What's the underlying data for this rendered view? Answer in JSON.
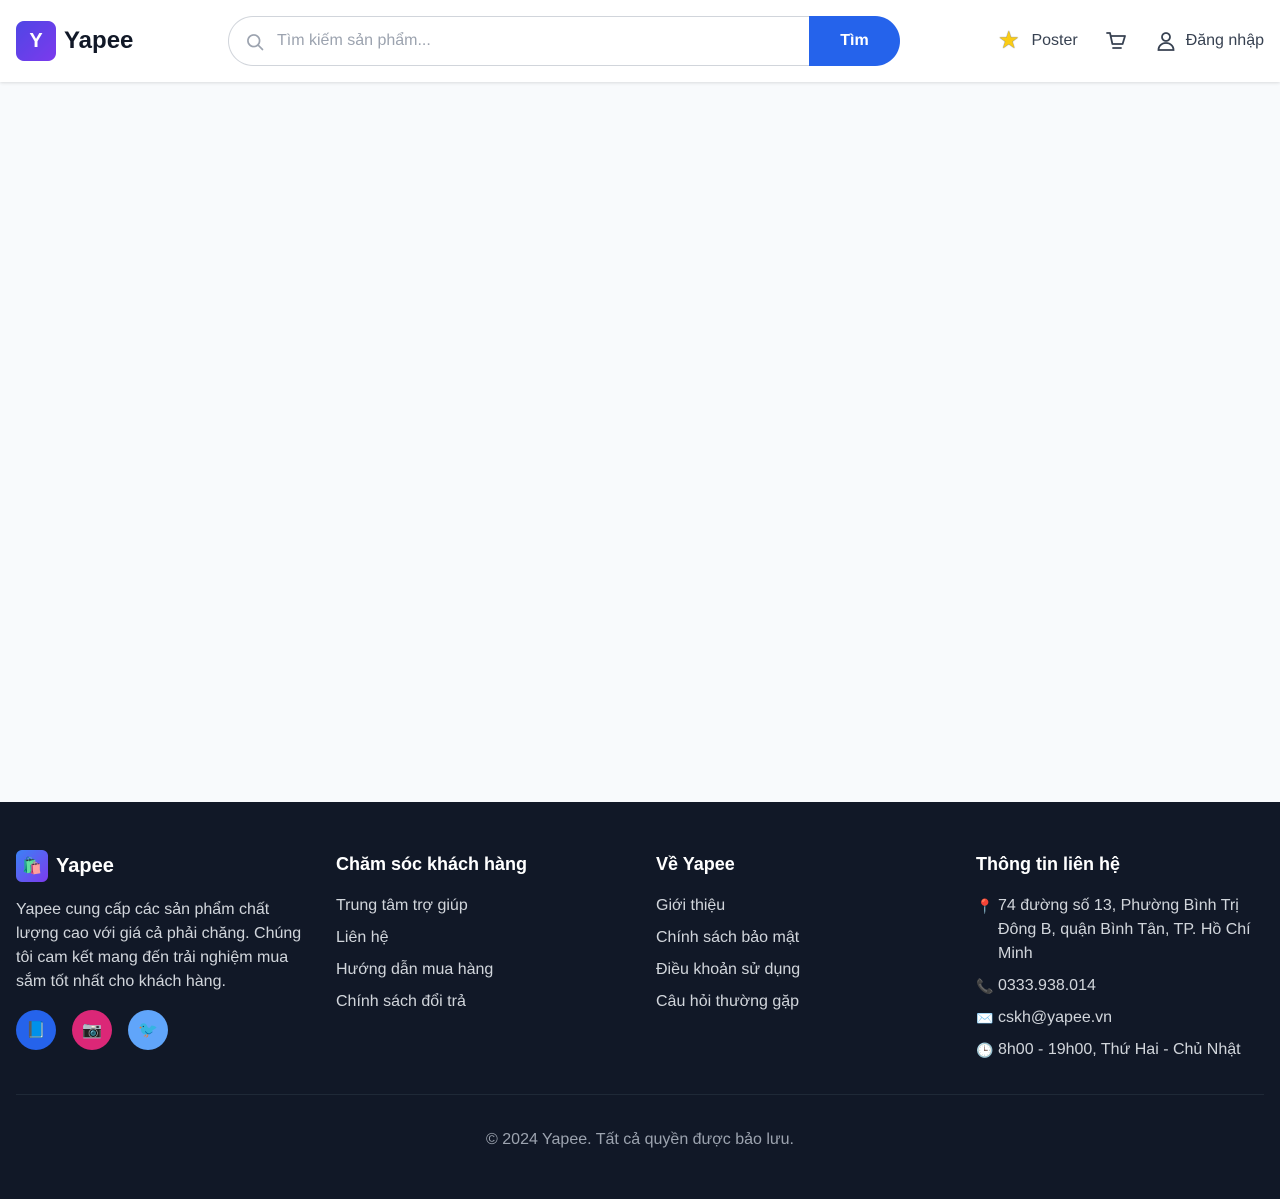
{
  "header": {
    "logo_letter": "Y",
    "brand": "Yapee",
    "search": {
      "placeholder": "Tìm kiếm sản phẩm...",
      "value": "",
      "button_label": "Tìm"
    },
    "poster_label": "Poster",
    "login_label": "Đăng nhập"
  },
  "footer": {
    "brand": "Yapee",
    "description": "Yapee cung cấp các sản phẩm chất lượng cao với giá cả phải chăng. Chúng tôi cam kết mang đến trải nghiệm mua sắm tốt nhất cho khách hàng.",
    "socials": [
      {
        "name": "facebook",
        "glyph": "📘",
        "color": "#2563eb"
      },
      {
        "name": "instagram",
        "glyph": "📷",
        "color": "#db2777"
      },
      {
        "name": "twitter",
        "glyph": "🐦",
        "color": "#60a5fa"
      }
    ],
    "customer_care": {
      "title": "Chăm sóc khách hàng",
      "links": [
        "Trung tâm trợ giúp",
        "Liên hệ",
        "Hướng dẫn mua hàng",
        "Chính sách đổi trả"
      ]
    },
    "about": {
      "title": "Về Yapee",
      "links": [
        "Giới thiệu",
        "Chính sách bảo mật",
        "Điều khoản sử dụng",
        "Câu hỏi thường gặp"
      ]
    },
    "contact": {
      "title": "Thông tin liên hệ",
      "items": [
        {
          "icon": "📍",
          "text": "74 đường số 13, Phường Bình Trị Đông B, quận Bình Tân, TP. Hồ Chí Minh"
        },
        {
          "icon": "📞",
          "text": "0333.938.014"
        },
        {
          "icon": "✉️",
          "text": "cskh@yapee.vn"
        },
        {
          "icon": "🕒",
          "text": "8h00 - 19h00, Thứ Hai - Chủ Nhật"
        }
      ]
    },
    "copyright": "© 2024 Yapee. Tất cả quyền được bảo lưu."
  },
  "colors": {
    "accent": "#2563eb",
    "footer_bg": "#111827",
    "page_bg": "#f8fafc"
  }
}
